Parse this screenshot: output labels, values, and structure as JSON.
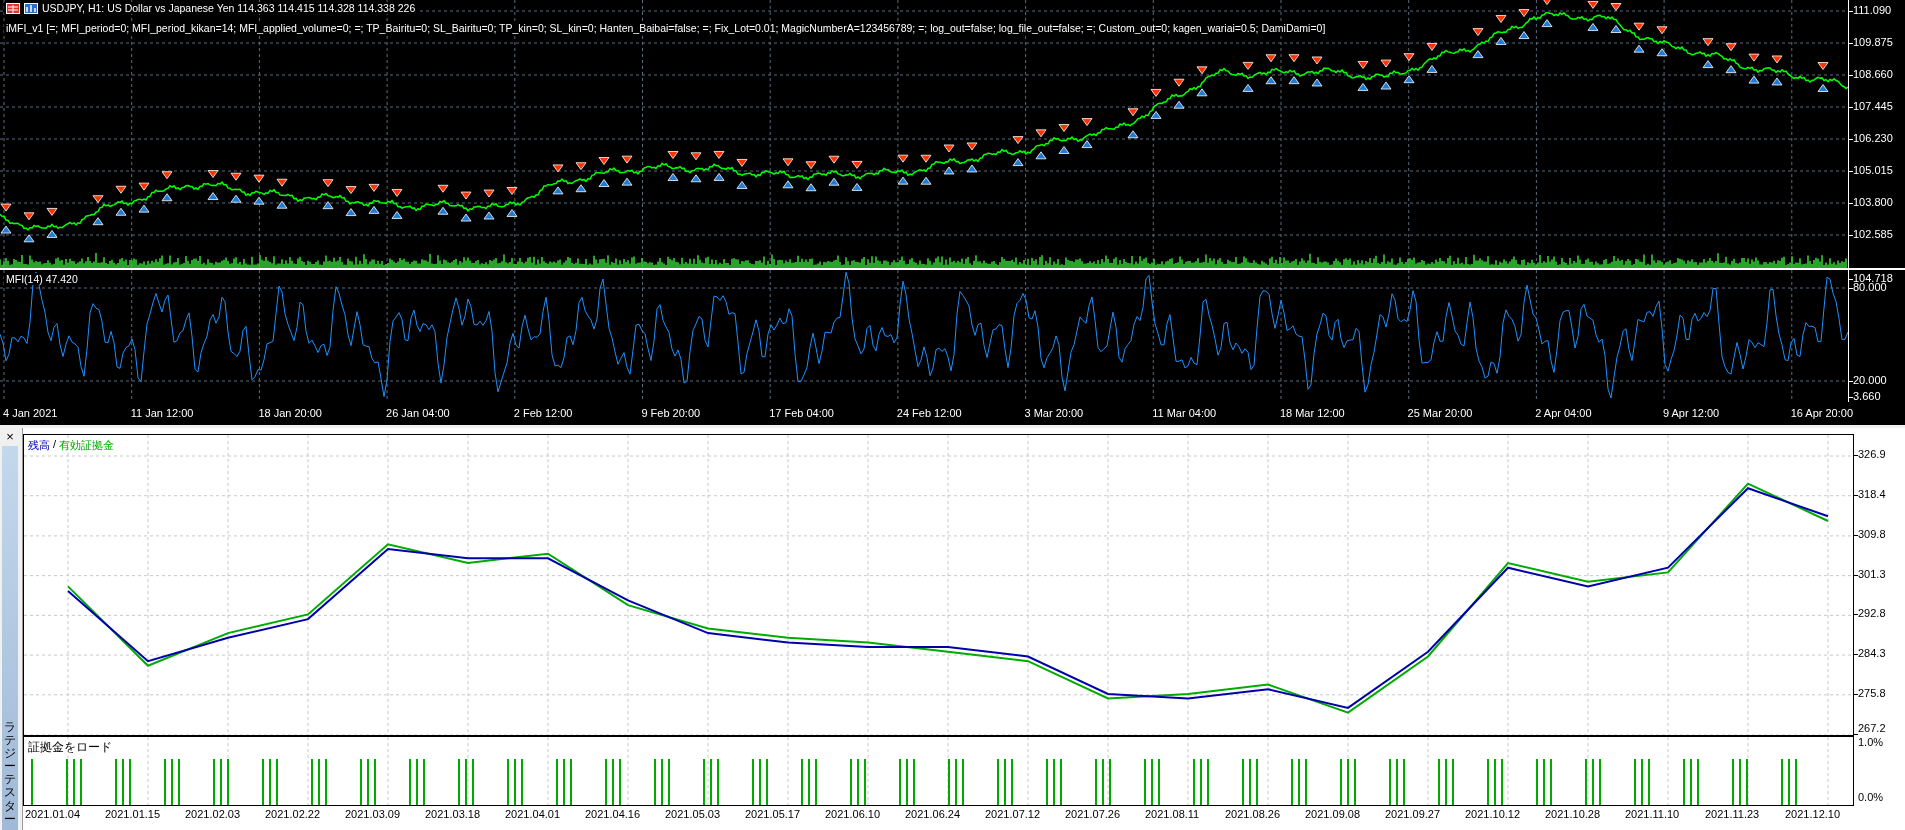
{
  "price_chart": {
    "title": "USDJPY, H1:  US Dollar vs Japanese Yen  114.363 114.415 114.328 114.338  226",
    "parameters": "iMFI_v1 [=; MFI_period=0; MFI_period_kikan=14; MFI_applied_volume=0; =; TP_Bairitu=0; SL_Bairitu=0; TP_kin=0; SL_kin=0; Hanten_Baibai=false; =; Fix_Lot=0.01; MagicNumberA=123456789; =; log_out=false; log_file_out=false; =; Custom_out=0; kagen_wariai=0.5;   DamiDami=0]",
    "y_labels": [
      "111.090",
      "109.875",
      "108.660",
      "107.445",
      "106.230",
      "105.015",
      "103.800",
      "102.585"
    ]
  },
  "mfi_panel": {
    "title": "MFI(14) 47.420",
    "y_labels": [
      "104.718",
      "80.000",
      "20.000",
      "3.660"
    ]
  },
  "time_axis": [
    "4 Jan 2021",
    "11 Jan 12:00",
    "18 Jan 20:00",
    "26 Jan 04:00",
    "2 Feb 12:00",
    "9 Feb 20:00",
    "17 Feb 04:00",
    "24 Feb 12:00",
    "3 Mar 20:00",
    "11 Mar 04:00",
    "18 Mar 12:00",
    "25 Mar 20:00",
    "2 Apr 04:00",
    "9 Apr 12:00",
    "16 Apr 20:00"
  ],
  "tester": {
    "close": "×",
    "tab_label": "ラテジーテスター",
    "legend_separator": "/",
    "chart_data": {
      "type": "line",
      "categories": [
        "2021.01.04",
        "2021.01.15",
        "2021.02.03",
        "2021.02.22",
        "2021.03.09",
        "2021.03.18",
        "2021.04.01",
        "2021.04.16",
        "2021.05.03",
        "2021.05.17",
        "2021.06.10",
        "2021.06.24",
        "2021.07.12",
        "2021.07.26",
        "2021.08.11",
        "2021.08.26",
        "2021.09.08",
        "2021.09.27",
        "2021.10.12",
        "2021.10.28",
        "2021.11.10",
        "2021.11.23",
        "2021.12.10"
      ],
      "grid": true,
      "yticks": [
        267.2,
        275.8,
        284.3,
        292.8,
        301.3,
        309.8,
        318.4,
        326.9
      ],
      "ylim": [
        267.2,
        326.9
      ],
      "series": [
        {
          "name": "残高",
          "color": "#0000aa",
          "values": [
            298,
            283,
            288,
            292,
            307,
            305,
            305,
            296,
            289,
            287,
            286,
            286,
            284,
            276,
            275,
            277,
            273,
            285,
            303,
            299,
            303,
            320,
            314
          ]
        },
        {
          "name": "有効証拠金",
          "color": "#00aa00",
          "values": [
            299,
            282,
            289,
            293,
            308,
            304,
            306,
            295,
            290,
            288,
            287,
            285,
            283,
            275,
            276,
            278,
            272,
            284,
            304,
            300,
            302,
            321,
            313
          ]
        }
      ]
    },
    "margin_panel": {
      "title": "証拠金をロード",
      "y_labels": [
        "1.0%",
        "0.0%"
      ]
    }
  }
}
